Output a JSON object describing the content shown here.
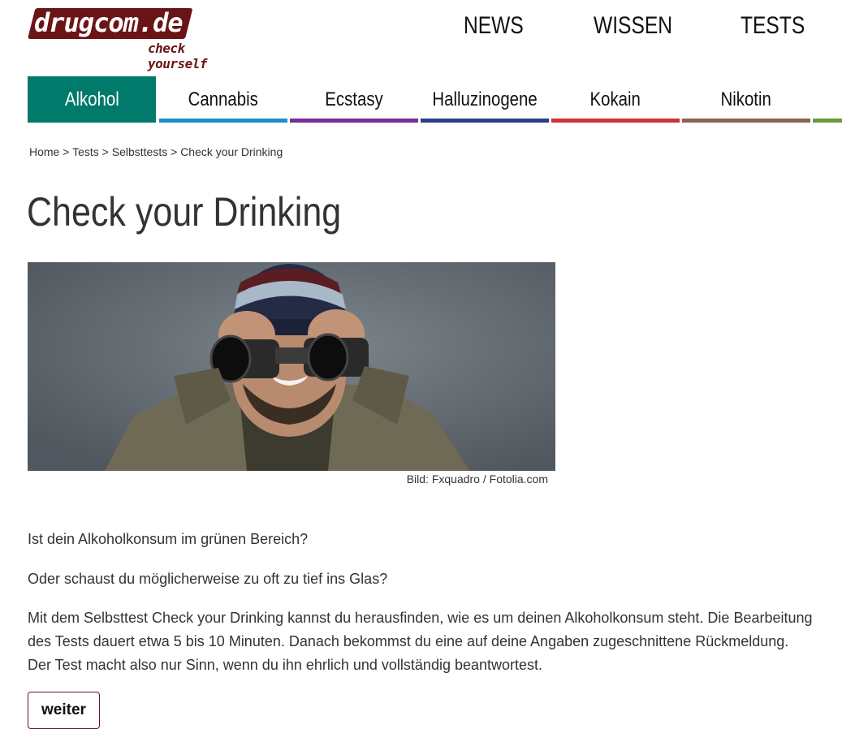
{
  "brand": {
    "logo_text": "drugcom.de",
    "tagline": "check yourself",
    "color": "#6b1416"
  },
  "topnav": [
    "NEWS",
    "WISSEN",
    "TESTS"
  ],
  "categories": [
    {
      "label": "Alkohol",
      "color": "#007a6a",
      "active": true
    },
    {
      "label": "Cannabis",
      "color": "#1a8ecb"
    },
    {
      "label": "Ecstasy",
      "color": "#7b2d96"
    },
    {
      "label": "Halluzinogene",
      "color": "#2c3e86"
    },
    {
      "label": "Kokain",
      "color": "#cc3333"
    },
    {
      "label": "Nikotin",
      "color": "#8b6450"
    },
    {
      "label": "",
      "color": "#6a9a3a"
    }
  ],
  "breadcrumb": {
    "items": [
      "Home",
      "Tests",
      "Selbsttests",
      "Check your Drinking"
    ],
    "separator": ">"
  },
  "page_title": "Check your Drinking",
  "image": {
    "credit": "Bild: Fxquadro / Fotolia.com"
  },
  "content": {
    "p1": "Ist dein Alkoholkonsum im grünen Bereich?",
    "p2": "Oder schaust du möglicherweise zu oft zu tief ins Glas?",
    "p3": "Mit dem Selbsttest Check your Drinking kannst du herausfinden, wie es um deinen Alkoholkonsum steht. Die Bearbeitung des Tests dauert etwa 5 bis 10 Minuten. Danach bekommst du eine auf deine Angaben zugeschnittene Rückmeldung. Der Test macht also nur Sinn, wenn du ihn ehrlich und vollständig beantwortest."
  },
  "button": {
    "label": "weiter"
  }
}
